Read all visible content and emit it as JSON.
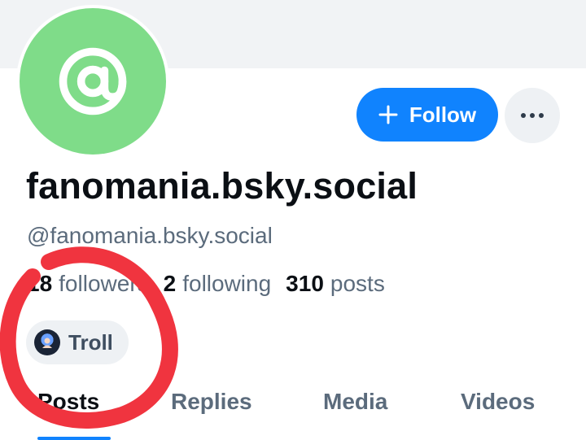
{
  "profile": {
    "display_name": "fanomania.bsky.social",
    "handle": "@fanomania.bsky.social",
    "avatar_glyph": "@",
    "avatar_color": "#7fdc89"
  },
  "actions": {
    "follow_label": "Follow",
    "more_label": "···",
    "accent": "#1083fe"
  },
  "stats": {
    "followers_count": "18",
    "followers_label": "followers",
    "following_count": "2",
    "following_label": "following",
    "posts_count": "310",
    "posts_label": "posts"
  },
  "labels": [
    {
      "text": "Troll",
      "icon": "labeler-avatar-icon"
    }
  ],
  "tabs": [
    {
      "label": "Posts",
      "active": true
    },
    {
      "label": "Replies",
      "active": false
    },
    {
      "label": "Media",
      "active": false
    },
    {
      "label": "Videos",
      "active": false
    }
  ],
  "annotation": {
    "shape": "circle",
    "color": "#f0343f"
  }
}
